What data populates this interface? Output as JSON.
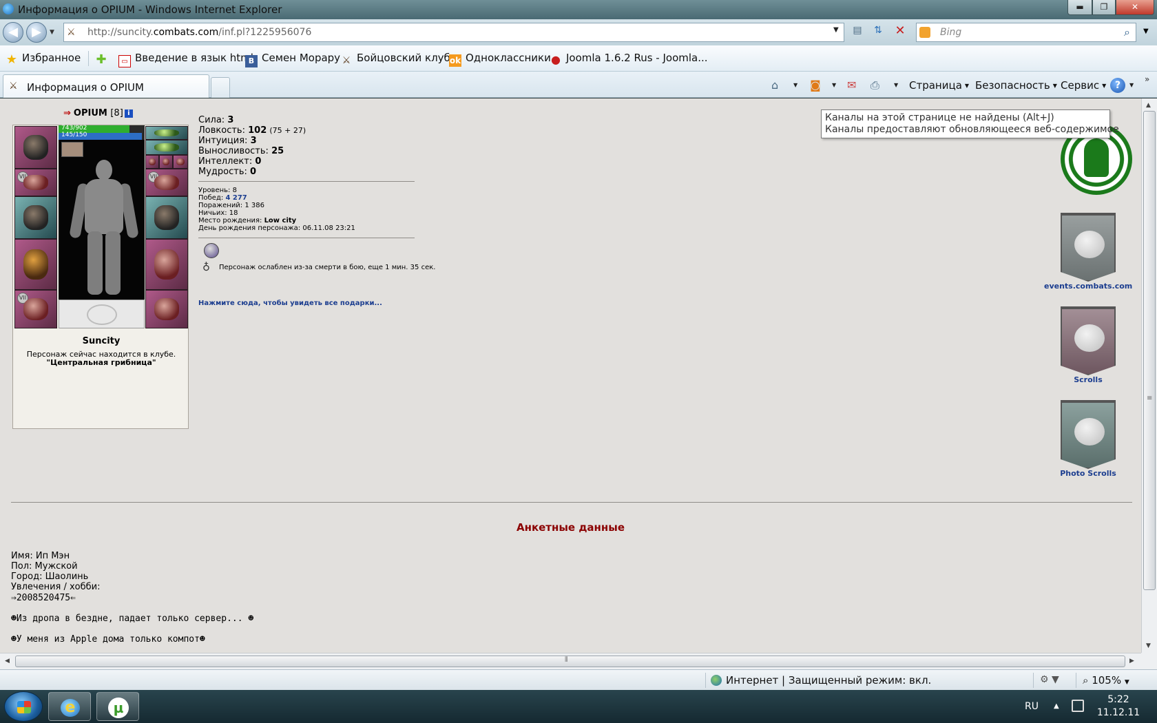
{
  "window": {
    "title": "Информация о OPIUM - Windows Internet Explorer",
    "min_label": "▬",
    "max_label": "❐",
    "close_label": "✕"
  },
  "address": {
    "url_prefix": "http://suncity.",
    "url_domain": "combats.com",
    "url_suffix": "/inf.pl?1225956076",
    "search_placeholder": "Bing"
  },
  "favorites": {
    "label": "Избранное",
    "items": [
      {
        "label": "Введение в язык html",
        "icon": "page-icon"
      },
      {
        "label": "Семен Морару",
        "icon": "vk-icon"
      },
      {
        "label": "Бойцовский клуб",
        "icon": "swords-icon"
      },
      {
        "label": "Одноклассники",
        "icon": "ok-icon"
      },
      {
        "label": "Joomla 1.6.2 Rus - Joomla...",
        "icon": "apple-icon"
      }
    ]
  },
  "tab": {
    "label": "Информация о OPIUM"
  },
  "commands": {
    "page": "Страница",
    "safety": "Безопасность",
    "service": "Сервис",
    "help": "?"
  },
  "tooltip": {
    "line1": "Каналы на этой странице не найдены (Alt+J)",
    "line2": "Каналы предоставляют обновляющееся веб-содержимое"
  },
  "character": {
    "name": "OPIUM",
    "level_text": "[8]",
    "info_label": "i",
    "hp_text": "743/902",
    "mp_text": "145/150",
    "hp_fraction": 0.824,
    "mp_fraction": 0.967,
    "city": "Suncity",
    "location_text": "Персонаж сейчас находится в клубе.",
    "club_name": "\"Центральная грибница\""
  },
  "stats": [
    {
      "label": "Сила:",
      "value": "3",
      "bonus": ""
    },
    {
      "label": "Ловкость:",
      "value": "102",
      "bonus": "(75 + 27)"
    },
    {
      "label": "Интуиция:",
      "value": "3",
      "bonus": ""
    },
    {
      "label": "Выносливость:",
      "value": "25",
      "bonus": ""
    },
    {
      "label": "Интеллект:",
      "value": "0",
      "bonus": ""
    },
    {
      "label": "Мудрость:",
      "value": "0",
      "bonus": ""
    }
  ],
  "info": {
    "level": "Уровень: 8",
    "wins_label": "Побед:",
    "wins_value": "4 277",
    "losses": "Поражений: 1 386",
    "draws": "Ничьих: 18",
    "birthplace_label": "Место рождения:",
    "birthplace_value": "Low city",
    "birthday": "День рождения персонажа: 06.11.08 23:21"
  },
  "effect": {
    "text": "Персонаж ослаблен из-за смерти в бою, еще 1 мин. 35 сек."
  },
  "gifts_link": "Нажмите сюда, чтобы увидеть все подарки...",
  "sponsors": [
    {
      "caption": "events.combats.com"
    },
    {
      "caption": "Scrolls"
    },
    {
      "caption": "Photo Scrolls"
    }
  ],
  "anketa": {
    "title": "Анкетные данные",
    "name": "Имя: Ип Мэн",
    "gender": "Пол: Мужской",
    "city": "Город: Шаолинь",
    "hobby_label": "Увлечения / хобби:",
    "line1": "⇒2008520475⇐",
    "line2": "☻Из дропа в бездне, падает только сервер... ☻",
    "line3": "☻У меня из Apple дома только компот☻"
  },
  "status": {
    "zone": "Интернет | Защищенный режим: вкл.",
    "zoom": "105%"
  },
  "taskbar": {
    "lang": "RU",
    "time": "5:22",
    "date": "11.12.11"
  }
}
